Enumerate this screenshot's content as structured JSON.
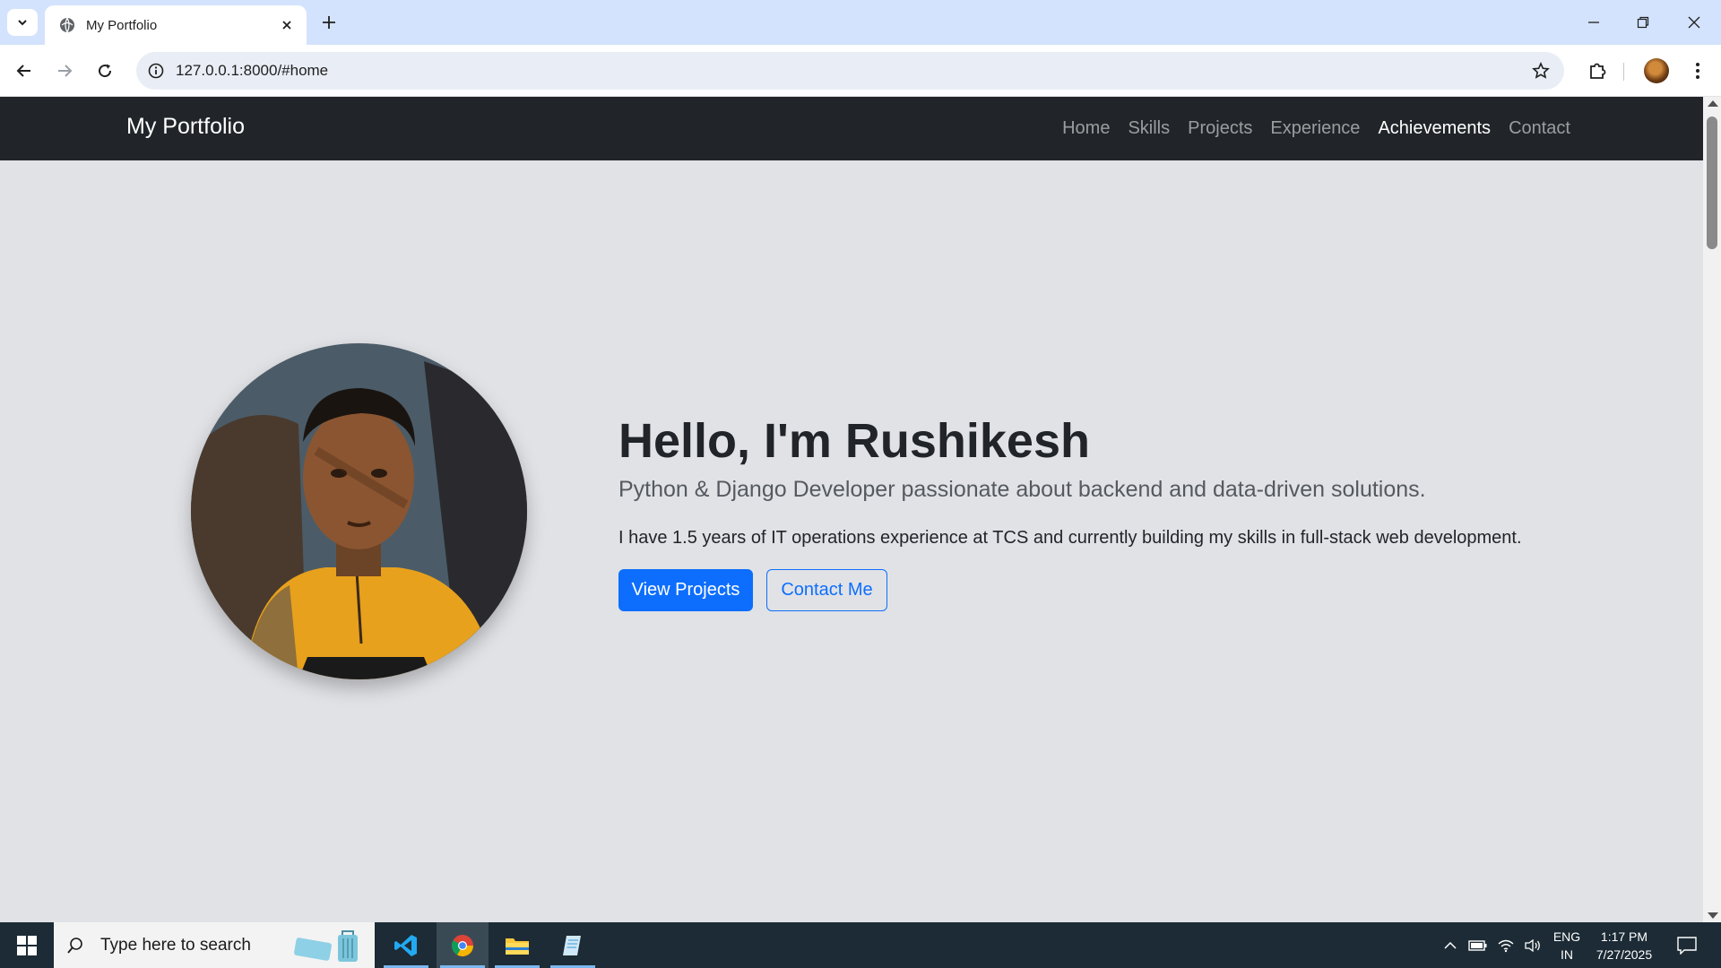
{
  "browser": {
    "tab_title": "My Portfolio",
    "url": "127.0.0.1:8000/#home"
  },
  "site": {
    "brand": "My Portfolio",
    "nav": [
      {
        "label": "Home"
      },
      {
        "label": "Skills"
      },
      {
        "label": "Projects"
      },
      {
        "label": "Experience"
      },
      {
        "label": "Achievements"
      },
      {
        "label": "Contact"
      }
    ],
    "active_nav": "Achievements"
  },
  "hero": {
    "title": "Hello, I'm Rushikesh",
    "subtitle": "Python & Django Developer passionate about backend and data-driven solutions.",
    "text": "I have 1.5 years of IT operations experience at TCS and currently building my skills in full-stack web development.",
    "primary_button": "View Projects",
    "secondary_button": "Contact Me"
  },
  "taskbar": {
    "search_placeholder": "Type here to search",
    "lang_line1": "ENG",
    "lang_line2": "IN",
    "time": "1:17 PM",
    "date": "7/27/2025"
  },
  "colors": {
    "navbar_bg": "#212529",
    "page_bg": "#e1e2e6",
    "primary": "#0d6efd",
    "tabbar_bg": "#d3e3fd",
    "taskbar_bg": "#1c2b35"
  }
}
